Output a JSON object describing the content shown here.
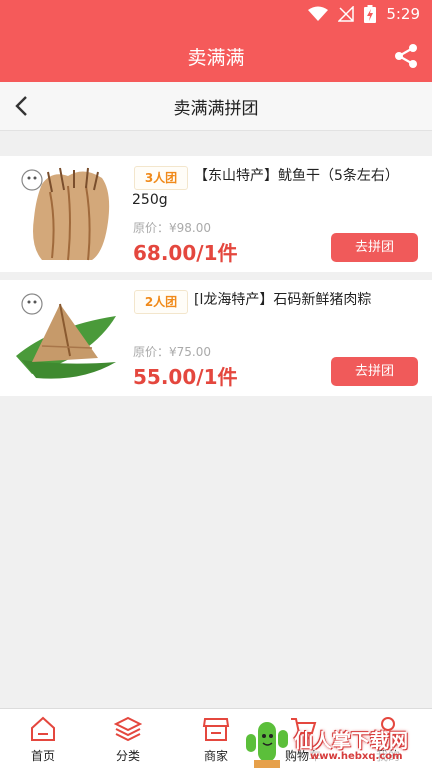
{
  "status_bar": {
    "time": "5:29"
  },
  "app_bar": {
    "title": "卖满满"
  },
  "nav": {
    "title": "卖满满拼团"
  },
  "products": [
    {
      "badge": "3人团",
      "title": "【东山特产】鱿鱼干（5条左右）250g",
      "original_price": "原价：¥98.00",
      "price": "68.00/1件",
      "button": "去拼团"
    },
    {
      "badge": "2人团",
      "title": "[l龙海特产】石码新鲜猪肉粽",
      "original_price": "原价：¥75.00",
      "price": "55.00/1件",
      "button": "去拼团"
    }
  ],
  "tabs": [
    {
      "label": "首页",
      "icon": "home-icon"
    },
    {
      "label": "分类",
      "icon": "layers-icon"
    },
    {
      "label": "商家",
      "icon": "store-icon"
    },
    {
      "label": "购物车",
      "icon": "cart-icon"
    },
    {
      "label": "我的",
      "icon": "user-icon"
    }
  ],
  "watermark": {
    "text": "仙人掌下载网",
    "url": "www.hebxq.com"
  },
  "colors": {
    "brand": "#f55a5a",
    "button": "#f05a5a",
    "price": "#e4473e",
    "badge": "#f08a1a"
  }
}
